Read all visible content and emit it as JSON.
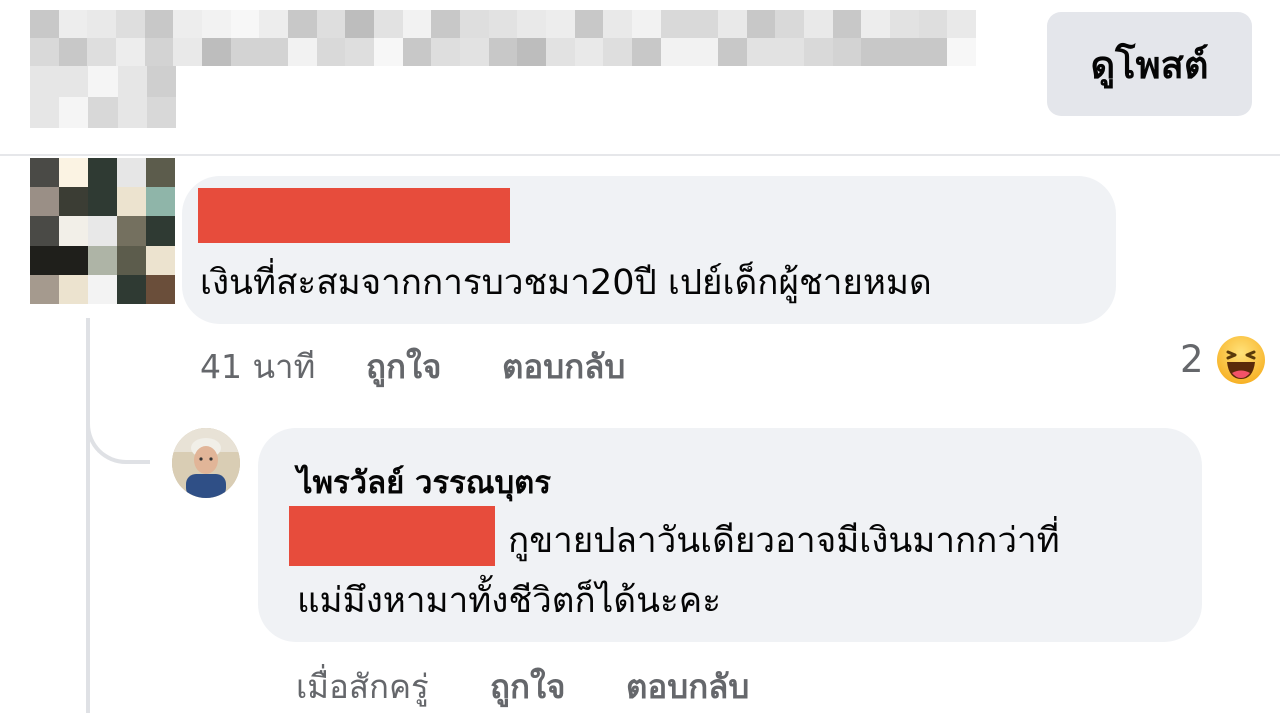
{
  "header": {
    "view_post_label": "ดูโพสต์"
  },
  "comment_1": {
    "text": "เงินที่สะสมจากการบวชมา20ปี เปย์เด็กผู้ชายหมด",
    "time": "41 นาที",
    "like_label": "ถูกใจ",
    "reply_label": "ตอบกลับ",
    "reaction_count": "2",
    "reaction_icon": "haha-emoji"
  },
  "reply_1": {
    "author": "ไพรวัลย์ วรรณบุตร",
    "text_line1": "กูขายปลาวันเดียวอาจมีเงินมากกว่าที่",
    "text_line2": "แม่มึงหามาทั้งชีวิตก็ได้นะคะ",
    "time": "เมื่อสักครู่",
    "like_label": "ถูกใจ",
    "reply_label": "ตอบกลับ"
  },
  "colors": {
    "bubble": "#f0f2f5",
    "redaction": "#e74c3c",
    "meta_text": "#65676b",
    "button_bg": "#e4e6eb"
  }
}
